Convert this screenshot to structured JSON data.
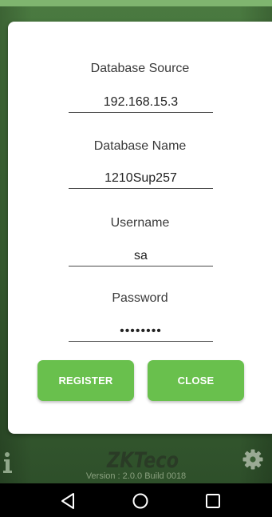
{
  "dialog": {
    "fields": [
      {
        "label": "Database Source",
        "value": "192.168.15.3"
      },
      {
        "label": "Database Name",
        "value": "1210Sup257"
      },
      {
        "label": "Username",
        "value": "sa"
      },
      {
        "label": "Password",
        "value": "••••••••"
      }
    ],
    "buttons": {
      "register": "REGISTER",
      "close": "CLOSE"
    }
  },
  "footer": {
    "version": "Version : 2.0.0 Build 0018",
    "logo_text": "ZKTeco"
  },
  "icons": {
    "info": "info-icon",
    "settings": "gear-icon",
    "back": "back-triangle-icon",
    "home": "home-circle-icon",
    "recents": "recents-square-icon"
  },
  "colors": {
    "accent": "#69c04d",
    "background": "#3f6a37",
    "dialog": "#ffffff"
  }
}
